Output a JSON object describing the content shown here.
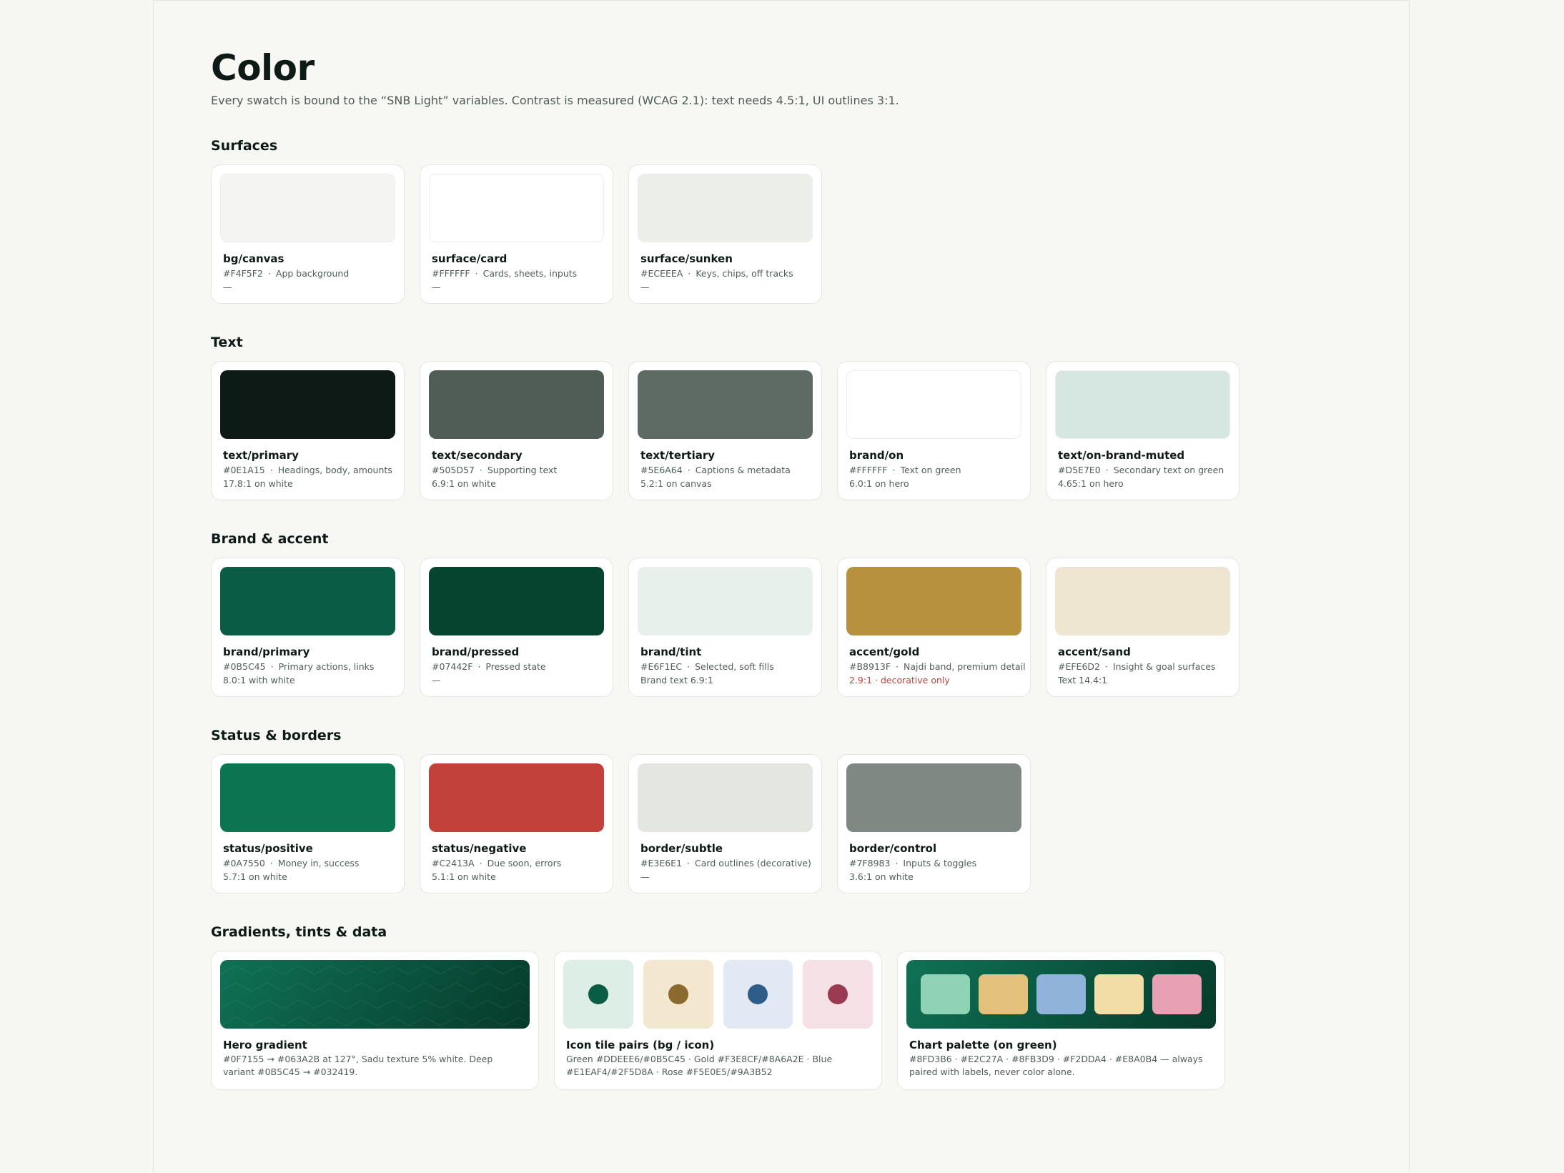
{
  "header": {
    "title": "Color",
    "subtitle": "Every swatch is bound to the “SNB Light” variables. Contrast is measured (WCAG 2.1): text needs 4.5:1, UI outlines 3:1."
  },
  "sections": [
    {
      "title": "Surfaces",
      "cards": [
        {
          "name": "bg/canvas",
          "hex": "#F4F5F2",
          "usage": "App background",
          "contrast": "—",
          "swatch": "#F4F5F2"
        },
        {
          "name": "surface/card",
          "hex": "#FFFFFF",
          "usage": "Cards, sheets, inputs",
          "contrast": "—",
          "swatch": "#FFFFFF"
        },
        {
          "name": "surface/sunken",
          "hex": "#ECEEEA",
          "usage": "Keys, chips, off tracks",
          "contrast": "—",
          "swatch": "#ECEEEA"
        }
      ]
    },
    {
      "title": "Text",
      "cards": [
        {
          "name": "text/primary",
          "hex": "#0E1A15",
          "usage": "Headings, body, amounts",
          "contrast": "17.8:1 on white",
          "swatch": "#0E1A15"
        },
        {
          "name": "text/secondary",
          "hex": "#505D57",
          "usage": "Supporting text",
          "contrast": "6.9:1 on white",
          "swatch": "#505D57"
        },
        {
          "name": "text/tertiary",
          "hex": "#5E6A64",
          "usage": "Captions & metadata",
          "contrast": "5.2:1 on canvas",
          "swatch": "#5E6A64"
        },
        {
          "name": "brand/on",
          "hex": "#FFFFFF",
          "usage": "Text on green",
          "contrast": "6.0:1 on hero",
          "swatch": "#FFFFFF"
        },
        {
          "name": "text/on-brand-muted",
          "hex": "#D5E7E0",
          "usage": "Secondary text on green",
          "contrast": "4.65:1 on hero",
          "swatch": "#D5E7E0"
        }
      ]
    },
    {
      "title": "Brand & accent",
      "cards": [
        {
          "name": "brand/primary",
          "hex": "#0B5C45",
          "usage": "Primary actions, links",
          "contrast": "8.0:1 with white",
          "swatch": "#0B5C45"
        },
        {
          "name": "brand/pressed",
          "hex": "#07442F",
          "usage": "Pressed state",
          "contrast": "—",
          "swatch": "#07442F"
        },
        {
          "name": "brand/tint",
          "hex": "#E6F1EC",
          "usage": "Selected, soft fills",
          "contrast": "Brand text 6.9:1",
          "swatch": "#E6F1EC"
        },
        {
          "name": "accent/gold",
          "hex": "#B8913F",
          "usage": "Najdi band, premium detail",
          "contrast": "2.9:1 · decorative only",
          "warn": true,
          "swatch": "#B8913F"
        },
        {
          "name": "accent/sand",
          "hex": "#EFE6D2",
          "usage": "Insight & goal surfaces",
          "contrast": "Text 14.4:1",
          "swatch": "#EFE6D2"
        }
      ]
    },
    {
      "title": "Status & borders",
      "cards": [
        {
          "name": "status/positive",
          "hex": "#0A7550",
          "usage": "Money in, success",
          "contrast": "5.7:1 on white",
          "swatch": "#0A7550"
        },
        {
          "name": "status/negative",
          "hex": "#C2413A",
          "usage": "Due soon, errors",
          "contrast": "5.1:1 on white",
          "swatch": "#C2413A"
        },
        {
          "name": "border/subtle",
          "hex": "#E3E6E1",
          "usage": "Card outlines (decorative)",
          "contrast": "—",
          "swatch": "#E3E6E1"
        },
        {
          "name": "border/control",
          "hex": "#7F8983",
          "usage": "Inputs & toggles",
          "contrast": "3.6:1 on white",
          "swatch": "#7F8983"
        }
      ]
    }
  ],
  "gradients": {
    "title": "Gradients, tints & data",
    "hero": {
      "name": "Hero gradient",
      "desc": "#0F7155 → #063A2B at 127°, Sadu texture 5% white. Deep variant #0B5C45 → #032419."
    },
    "icon_tiles": {
      "name": "Icon tile pairs (bg / icon)",
      "desc": "Green #DDEEE6/#0B5C45 · Gold #F3E8CF/#8A6A2E · Blue #E1EAF4/#2F5D8A · Rose #F5E0E5/#9A3B52",
      "pairs": [
        {
          "bg": "#DDEEE6",
          "icon": "#0B5C45"
        },
        {
          "bg": "#F3E8CF",
          "icon": "#8A6A2E"
        },
        {
          "bg": "#E1EAF4",
          "icon": "#2F5D8A"
        },
        {
          "bg": "#F5E0E5",
          "icon": "#9A3B52"
        }
      ]
    },
    "chart_palette": {
      "name": "Chart palette (on green)",
      "desc": "#8FD3B6 · #E2C27A · #8FB3D9 · #F2DDA4 · #E8A0B4 — always paired with labels, never color alone.",
      "colors": [
        "#8FD3B6",
        "#E2C27A",
        "#8FB3D9",
        "#F2DDA4",
        "#E8A0B4"
      ]
    }
  }
}
